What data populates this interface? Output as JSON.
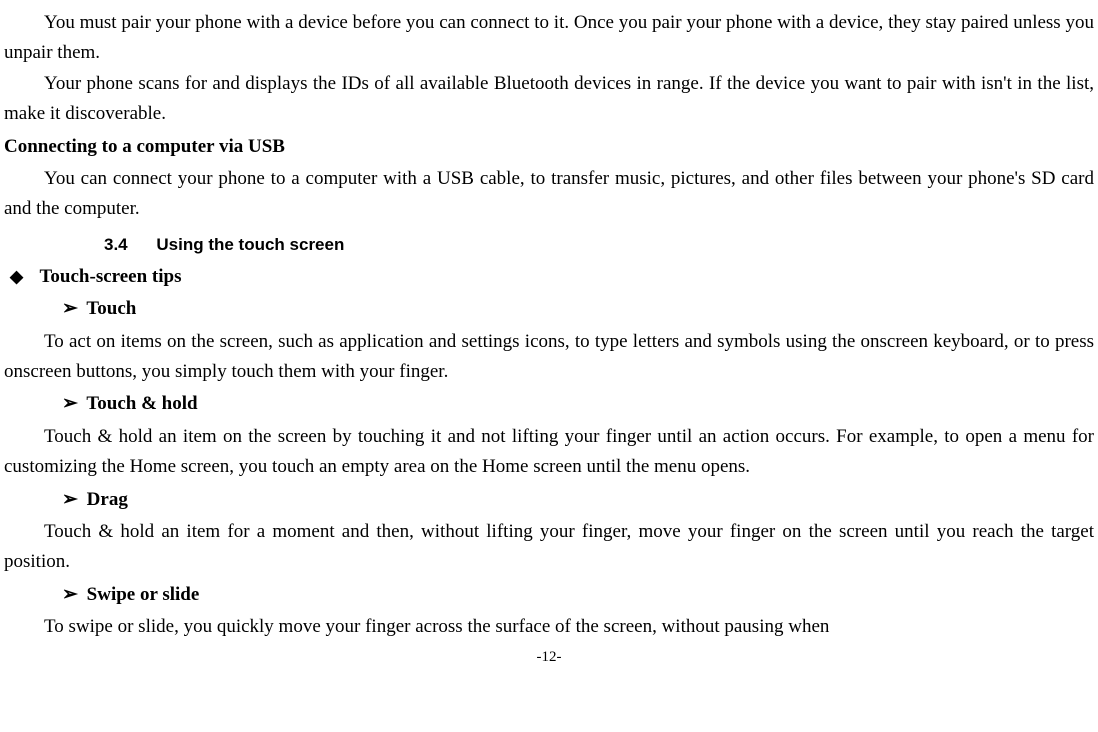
{
  "p1": "You must pair your phone with a device before you can connect to it. Once you pair your phone with a device, they stay paired unless you unpair them.",
  "p2": "Your phone scans for and displays the IDs of all available Bluetooth devices in range. If the device you want to pair with isn't in the list, make it discoverable.",
  "h1": "Connecting to a computer via USB",
  "p3": "You can connect your phone to a computer with a USB cable, to transfer music, pictures, and other files between your phone's SD card and the computer.",
  "section_number": "3.4",
  "section_title": "Using the touch screen",
  "tips_title": "Touch-screen tips",
  "touch_h": "Touch",
  "touch_p": "To act on items on the screen, such as application and settings icons, to type letters and symbols using the onscreen keyboard, or to press onscreen buttons, you simply touch them with your finger.",
  "touchhold_h": "Touch & hold",
  "touchhold_p": "Touch & hold an item on the screen by touching it and not lifting your finger until an action occurs. For example, to open a menu for customizing the Home screen, you touch an empty area on the Home screen until the menu opens.",
  "drag_h": "Drag",
  "drag_p": "Touch & hold an item for a moment and then, without lifting your finger, move your finger on the screen until you reach the target position.",
  "swipe_h": "Swipe or slide",
  "swipe_p": "To swipe or slide, you quickly move your finger across the surface of the screen, without pausing when",
  "page": "-12-",
  "diamond_glyph": "◆",
  "arrow_glyph": "➢"
}
